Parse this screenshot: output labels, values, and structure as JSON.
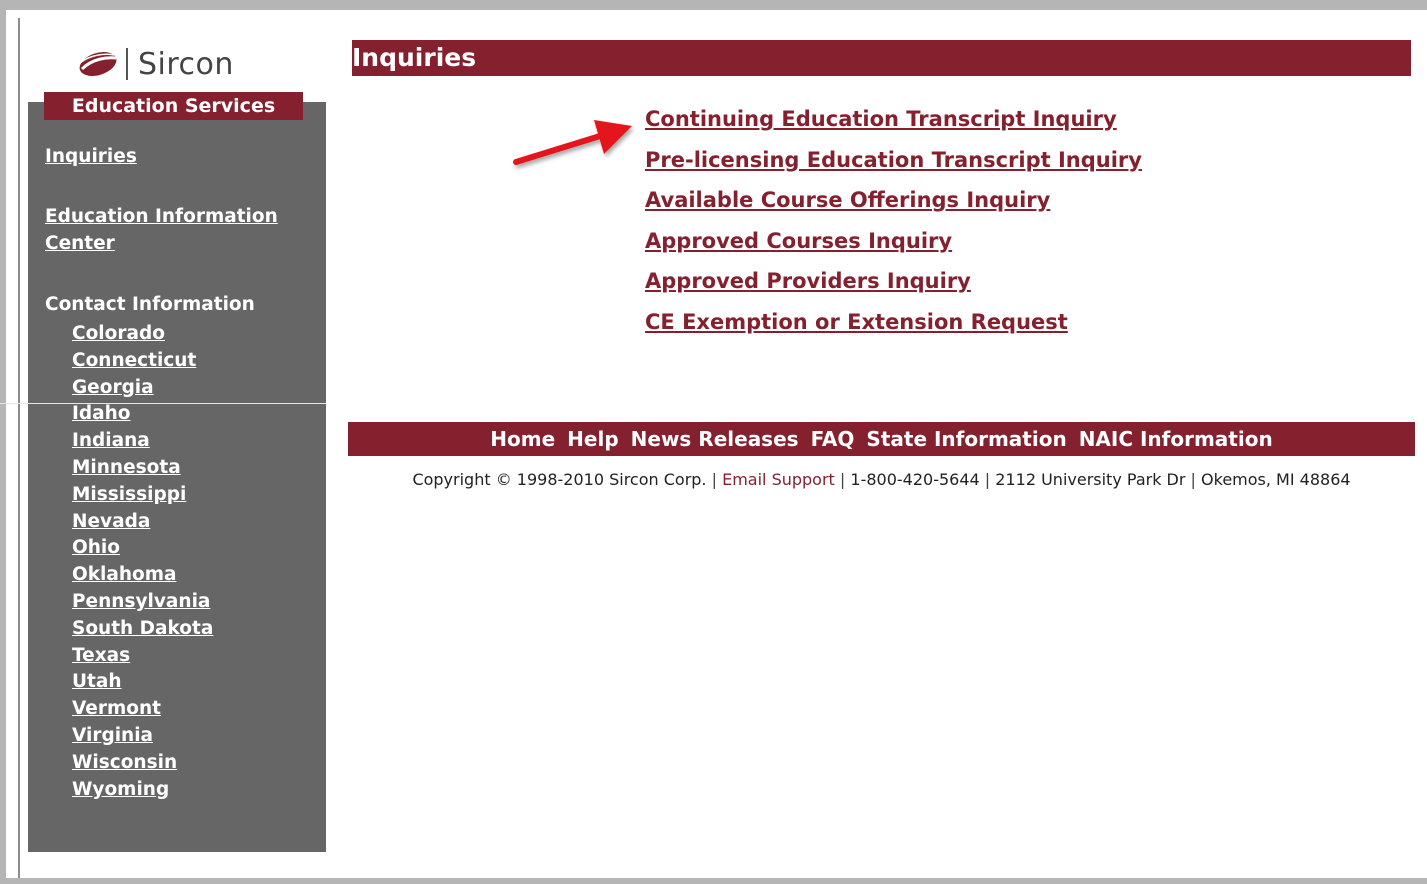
{
  "brand": {
    "logo_text": "Sircon",
    "section": "Education Services",
    "accent_color": "#85202f",
    "sidebar_color": "#666666"
  },
  "sidebar": {
    "inquiries": "Inquiries",
    "edu_info_line1": "Education Information",
    "edu_info_line2": "Center",
    "contact_label": "Contact Information",
    "states": [
      "Colorado",
      "Connecticut",
      "Georgia",
      "Idaho",
      "Indiana",
      "Minnesota",
      "Mississippi",
      "Nevada",
      "Ohio",
      "Oklahoma",
      "Pennsylvania",
      "South Dakota",
      "Texas",
      "Utah",
      "Vermont",
      "Virginia",
      "Wisconsin",
      "Wyoming"
    ]
  },
  "main": {
    "title": "Inquiries",
    "links": [
      "Continuing Education Transcript Inquiry",
      "Pre-licensing Education Transcript Inquiry",
      "Available Course Offerings Inquiry",
      "Approved Courses Inquiry",
      "Approved Providers Inquiry",
      "CE Exemption or Extension Request"
    ]
  },
  "footer": {
    "nav": [
      "Home",
      "Help",
      "News Releases",
      "FAQ",
      "State Information",
      "NAIC Information"
    ],
    "copyright": "Copyright © 1998-2010 Sircon Corp.",
    "email_support": "Email Support",
    "phone": "1-800-420-5644",
    "address": "2112 University Park Dr",
    "city": "Okemos, MI 48864"
  }
}
